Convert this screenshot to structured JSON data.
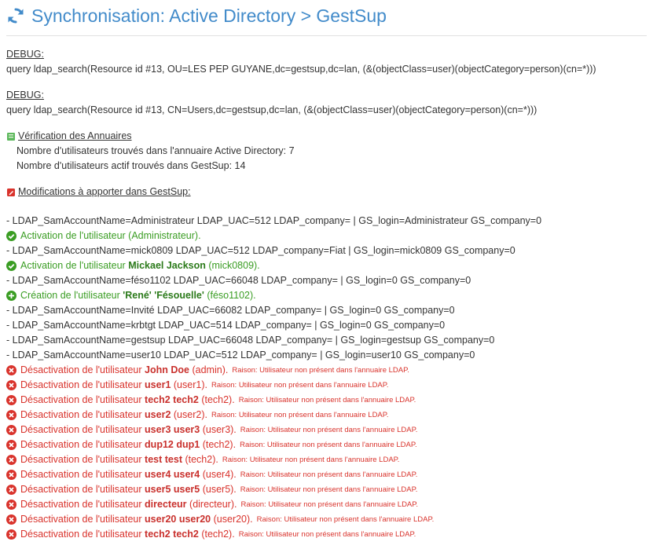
{
  "header": {
    "title": "Synchronisation: Active Directory > GestSup",
    "icon": "sync-icon"
  },
  "debug": [
    {
      "label": "DEBUG:",
      "query": "query ldap_search(Resource id #13, OU=LES PEP GUYANE,dc=gestsup,dc=lan, (&(objectClass=user)(objectCategory=person)(cn=*)))"
    },
    {
      "label": "DEBUG:",
      "query": "query ldap_search(Resource id #13, CN=Users,dc=gestsup,dc=lan, (&(objectClass=user)(objectCategory=person)(cn=*)))"
    }
  ],
  "verification": {
    "title": "Vérification des Annuaires",
    "lines": [
      "Nombre d'utilisateurs trouvés dans l'annuaire Active Directory: 7",
      "Nombre d'utilisateurs actif trouvés dans GestSup: 14"
    ]
  },
  "modifications": {
    "title": "Modifications à apporter dans GestSup:",
    "reason_text": "Raison: Utilisateur non présent dans l'annuaire LDAP.",
    "sep": "|",
    "ldap": [
      {
        "left": "- LDAP_SamAccountName=Administrateur LDAP_UAC=512 LDAP_company=",
        "right": "GS_login=Administrateur GS_company=0"
      },
      {
        "left": "- LDAP_SamAccountName=mick0809 LDAP_UAC=512 LDAP_company=Fiat",
        "right": "GS_login=mick0809 GS_company=0"
      },
      {
        "left": "- LDAP_SamAccountName=féso1102 LDAP_UAC=66048 LDAP_company=",
        "right": "GS_login=0 GS_company=0"
      },
      {
        "left": "- LDAP_SamAccountName=Invité LDAP_UAC=66082 LDAP_company=",
        "right": "GS_login=0 GS_company=0"
      },
      {
        "left": "- LDAP_SamAccountName=krbtgt LDAP_UAC=514 LDAP_company=",
        "right": "GS_login=0 GS_company=0"
      },
      {
        "left": "- LDAP_SamAccountName=gestsup LDAP_UAC=66048 LDAP_company=",
        "right": "GS_login=gestsup GS_company=0"
      },
      {
        "left": "- LDAP_SamAccountName=user10 LDAP_UAC=512 LDAP_company=",
        "right": "GS_login=user10 GS_company=0"
      }
    ],
    "activation_1": "Activation de l'utilisateur (Administrateur).",
    "activation_2": {
      "prefix": "Activation de l'utilisateur",
      "name": "Mickael Jackson",
      "login": "(mick0809)."
    },
    "creation": {
      "prefix": "Création de l'utilisateur",
      "first": "'René'",
      "last": "'Fésouelle'",
      "login": "(féso1102)."
    },
    "deactivations": [
      {
        "prefix": "Désactivation de l'utilisateur",
        "name": "John Doe",
        "login": "(admin)."
      },
      {
        "prefix": "Désactivation de l'utilisateur",
        "name": "user1",
        "login": "(user1)."
      },
      {
        "prefix": "Désactivation de l'utilisateur",
        "name": "tech2 tech2",
        "login": "(tech2)."
      },
      {
        "prefix": "Désactivation de l'utilisateur",
        "name": "user2",
        "login": "(user2)."
      },
      {
        "prefix": "Désactivation de l'utilisateur",
        "name": "user3 user3",
        "login": "(user3)."
      },
      {
        "prefix": "Désactivation de l'utilisateur",
        "name": "dup12 dup1",
        "login": "(tech2)."
      },
      {
        "prefix": "Désactivation de l'utilisateur",
        "name": "test test",
        "login": "(tech2)."
      },
      {
        "prefix": "Désactivation de l'utilisateur",
        "name": "user4 user4",
        "login": "(user4)."
      },
      {
        "prefix": "Désactivation de l'utilisateur",
        "name": "user5 user5",
        "login": "(user5)."
      },
      {
        "prefix": "Désactivation de l'utilisateur",
        "name": "directeur",
        "login": "(directeur)."
      },
      {
        "prefix": "Désactivation de l'utilisateur",
        "name": "user20 user20",
        "login": "(user20)."
      },
      {
        "prefix": "Désactivation de l'utilisateur",
        "name": "tech2 tech2",
        "login": "(tech2)."
      }
    ]
  },
  "colors": {
    "title": "#428bca",
    "success": "#3a9d23",
    "danger": "#d9332c"
  }
}
